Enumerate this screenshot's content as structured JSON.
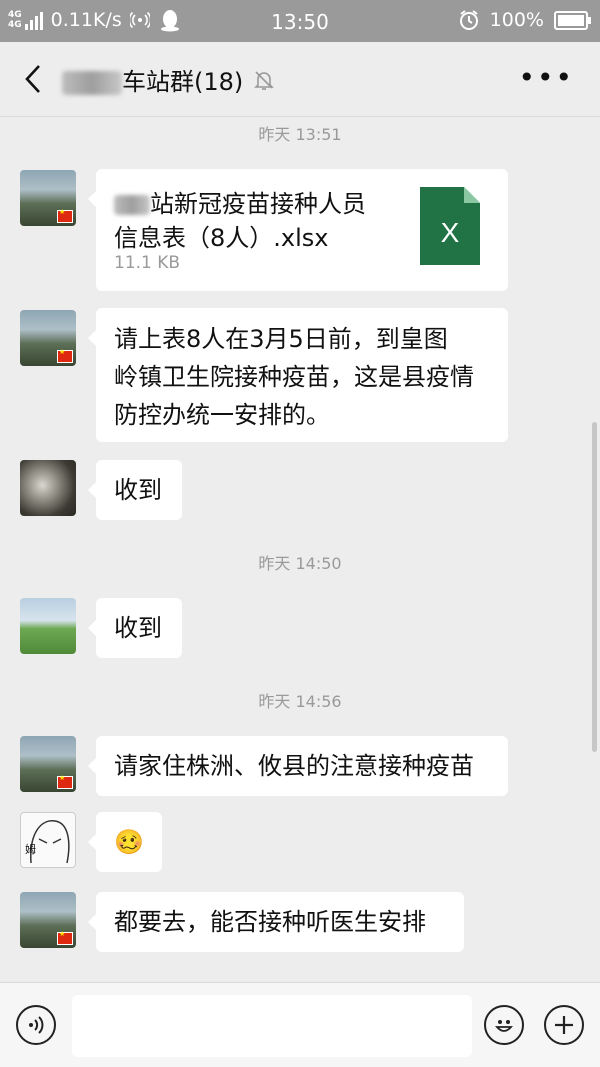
{
  "status_bar": {
    "network": "4G",
    "network2": "4G",
    "speed": "0.11K/s",
    "time": "13:50",
    "battery": "100%"
  },
  "header": {
    "title_visible": "车站群(18)"
  },
  "messages": {
    "ts1": "昨天 13:51",
    "file_name": "站新冠疫苗接种人员信息表（8人）.xlsx",
    "file_name_line1": "站新冠疫苗接种人员",
    "file_name_line2": "信息表（8人）.xlsx",
    "file_size": "11.1 KB",
    "file_icon_letter": "X",
    "msg2_line1": "请上表8人在3月5日前，到皇图",
    "msg2_line2": "岭镇卫生院接种疫苗，这是县疫情",
    "msg2_line3": "防控办统一安排的。",
    "msg3": "收到",
    "ts2": "昨天 14:50",
    "msg4": "收到",
    "ts3": "昨天 14:56",
    "msg5": "请家住株洲、攸县的注意接种疫苗",
    "msg6_emoji": "🥴",
    "msg7": "都要去，能否接种听医生安排"
  },
  "colors": {
    "excel_green": "#217346",
    "status_bg": "#9a9a9a",
    "chat_bg": "#ededed"
  },
  "icons": [
    "back-arrow-icon",
    "mute-bell-icon",
    "more-icon",
    "voice-icon",
    "emoji-icon",
    "plus-icon"
  ]
}
